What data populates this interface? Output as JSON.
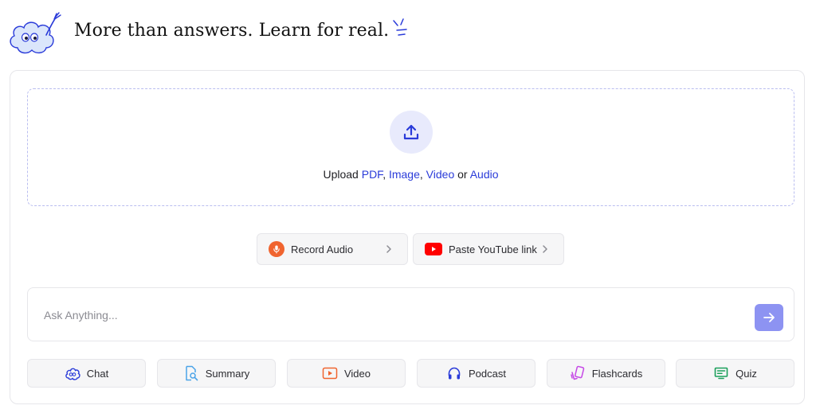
{
  "header": {
    "headline": "More than answers. Learn for real."
  },
  "upload": {
    "prefix": "Upload ",
    "pdf": "PDF",
    "sep1": ", ",
    "image": "Image",
    "sep2": ", ",
    "video": "Video",
    "or": " or ",
    "audio": "Audio",
    "link_color": "#2a3bd9"
  },
  "actions": {
    "record_audio": "Record Audio",
    "youtube": "Paste YouTube link"
  },
  "ask": {
    "placeholder": "Ask Anything..."
  },
  "modes": [
    {
      "label": "Chat",
      "icon": "chat-cloud-icon",
      "color": "#2a3bd9"
    },
    {
      "label": "Summary",
      "icon": "summary-doc-icon",
      "color": "#4aa3e8"
    },
    {
      "label": "Video",
      "icon": "video-play-icon",
      "color": "#f0642f"
    },
    {
      "label": "Podcast",
      "icon": "headphones-icon",
      "color": "#2a3bd9"
    },
    {
      "label": "Flashcards",
      "icon": "flashcards-icon",
      "color": "#c548e6"
    },
    {
      "label": "Quiz",
      "icon": "quiz-board-icon",
      "color": "#1a9f5a"
    }
  ],
  "colors": {
    "accent": "#8d93f2",
    "upload_bg": "#e8eafc",
    "record": "#f0642f",
    "youtube": "#ff0000"
  }
}
